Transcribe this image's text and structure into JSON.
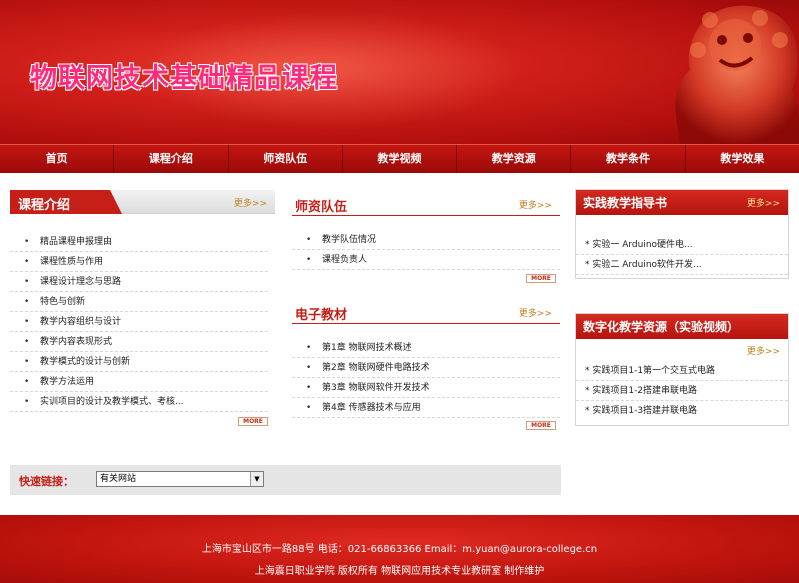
{
  "banner": {
    "title": "物联网技术基础精品课程"
  },
  "nav": [
    "首页",
    "课程介绍",
    "师资队伍",
    "教学视频",
    "教学资源",
    "教学条件",
    "教学效果"
  ],
  "left": {
    "title": "课程介绍",
    "more": "更多>>",
    "items": [
      "精品课程申报理由",
      "课程性质与作用",
      "课程设计理念与思路",
      "特色与创新",
      "教学内容组织与设计",
      "教学内容表现形式",
      "教学模式的设计与创新",
      "教学方法运用",
      "实训项目的设计及教学模式、考核..."
    ],
    "more_btn": "MORE"
  },
  "faculty": {
    "title": "师资队伍",
    "more": "更多>>",
    "items": [
      "教学队伍情况",
      "课程负责人"
    ],
    "more_btn": "MORE"
  },
  "textbook": {
    "title": "电子教材",
    "more": "更多>>",
    "items": [
      "第1章 物联网技术概述",
      "第2章 物联网硬件电路技术",
      "第3章 物联网软件开发技术",
      "第4章 传感器技术与应用"
    ],
    "more_btn": "MORE"
  },
  "guide": {
    "title": "实践教学指导书",
    "more": "更多>>",
    "items": [
      "* 实验一 Arduino硬件电...",
      "* 实验二 Arduino软件开发..."
    ]
  },
  "digital": {
    "title": "数字化教学资源（实验视频）",
    "more": "更多>>",
    "items": [
      "* 实践项目1-1第一个交互式电路",
      "* 实践项目1-2搭建串联电路",
      "* 实践项目1-3搭建并联电路"
    ]
  },
  "quick": {
    "label": "快速链接：",
    "selected": "有关网站"
  },
  "footer": {
    "line1": "上海市宝山区市一路88号  电话：021-66863366  Email：m.yuan@aurora-college.cn",
    "line2": "上海震日职业学院 版权所有 物联网应用技术专业教研室 制作维护"
  },
  "colors": {
    "brand_red": "#c51f18",
    "nav_red": "#b0100d",
    "title_pink": "#ff2a7a"
  }
}
